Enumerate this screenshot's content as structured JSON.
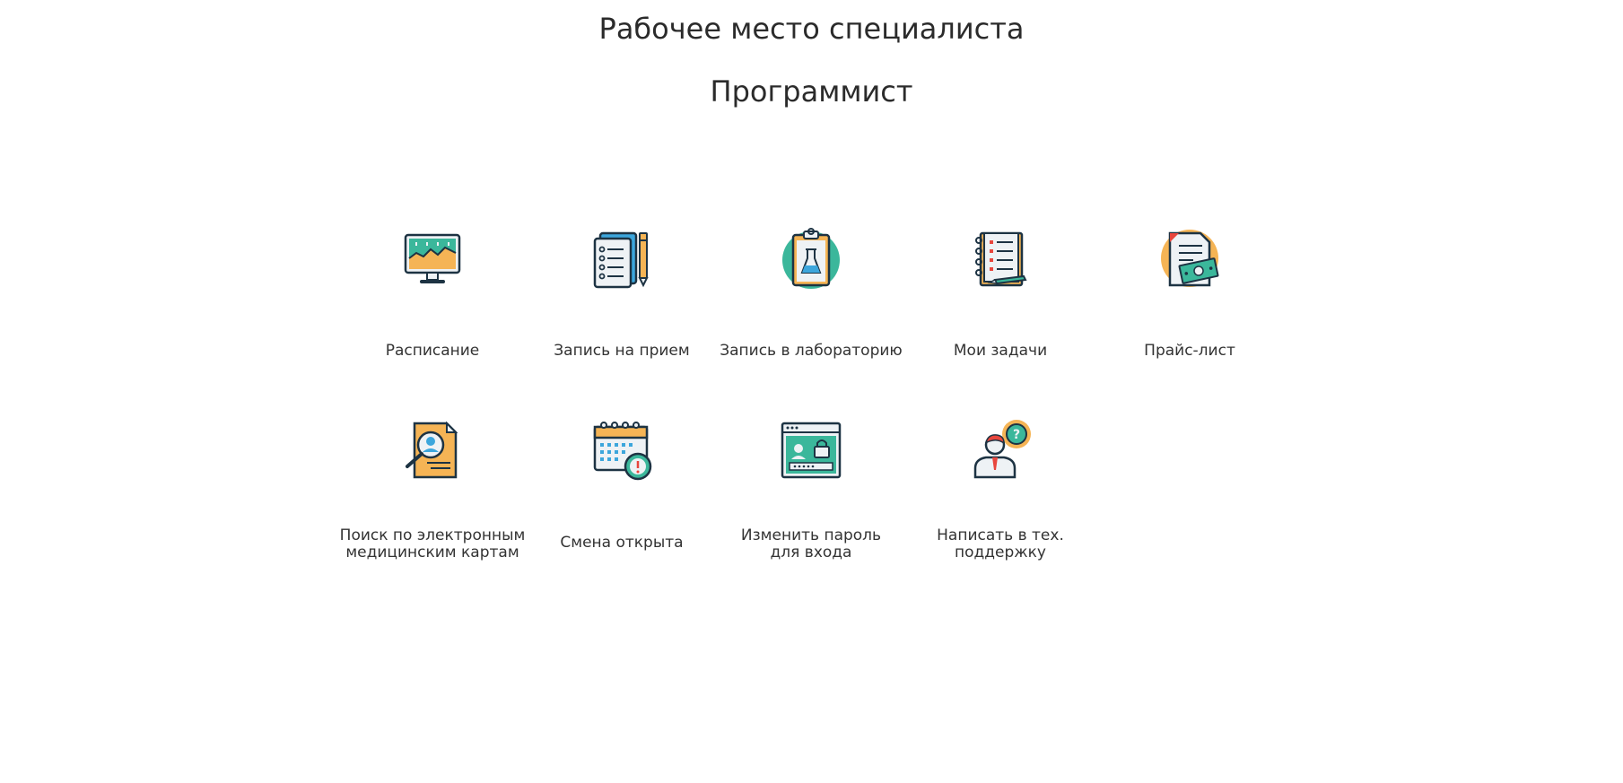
{
  "header": {
    "title": "Рабочее место специалиста",
    "role": "Программист"
  },
  "tiles": [
    {
      "label": "Расписание",
      "icon": "monitor-chart-icon"
    },
    {
      "label": "Запись на прием",
      "icon": "checklist-pencil-icon"
    },
    {
      "label": "Запись в лабораторию",
      "icon": "clipboard-flask-icon"
    },
    {
      "label": "Мои задачи",
      "icon": "notebook-tasks-icon"
    },
    {
      "label": "Прайс-лист",
      "icon": "price-document-cash-icon"
    },
    {
      "label": "Поиск по электронным\nмедицинским картам",
      "icon": "document-search-person-icon"
    },
    {
      "label": "Смена открыта",
      "icon": "calendar-clock-icon"
    },
    {
      "label": "Изменить пароль\nдля входа",
      "icon": "browser-lock-icon"
    },
    {
      "label": "Написать в тех.\nподдержку",
      "icon": "support-person-question-icon"
    }
  ],
  "colors": {
    "teal": "#3bb79b",
    "orange": "#f5b455",
    "navy": "#1d3343",
    "blue": "#3ca6dc",
    "red": "#e8463d",
    "paper": "#eef2f5"
  }
}
